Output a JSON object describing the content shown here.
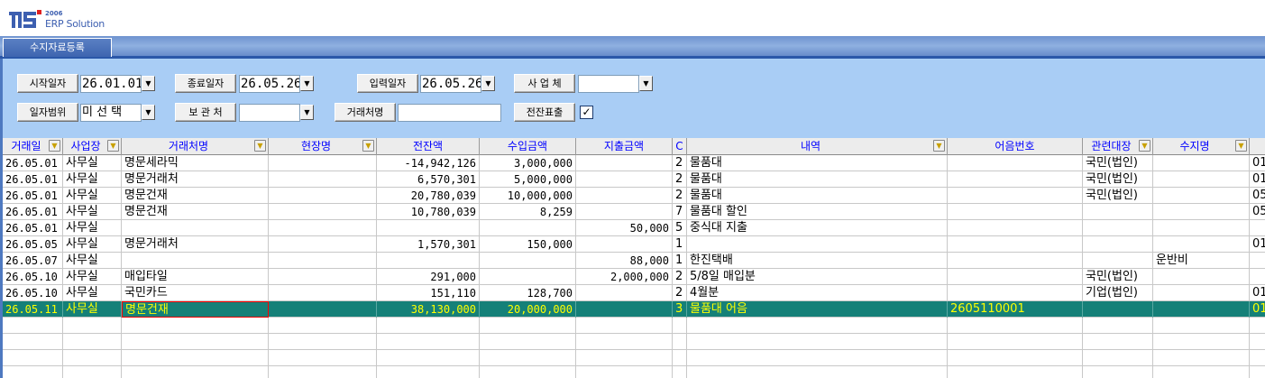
{
  "app": {
    "logo_year": "2006",
    "logo_name": "ERP Solution"
  },
  "tab": {
    "label": "수지자료등록"
  },
  "filters": {
    "start_date_label": "시작일자",
    "start_date_value": "26.01.01",
    "end_date_label": "종료일자",
    "end_date_value": "26.05.26",
    "input_date_label": "입력일자",
    "input_date_value": "26.05.26",
    "company_label": "사 업 체",
    "company_value": "",
    "date_range_label": "일자범위",
    "date_range_value": "미 선 택",
    "storage_label": "보 관 처",
    "storage_value": "",
    "vendor_label": "거래처명",
    "vendor_value": "",
    "slip_label": "전잔표출",
    "slip_checked": "✓"
  },
  "grid": {
    "columns": [
      "거래일",
      "사업장",
      "거래처명",
      "현장명",
      "전잔액",
      "수입금액",
      "지출금액",
      "C",
      "내역",
      "어음번호",
      "관련대장",
      "수지명"
    ],
    "rows": [
      {
        "date": "26.05.01",
        "site": "사무실",
        "vendor": "명문세라믹",
        "field": "",
        "balance": "-14,942,126",
        "income": "3,000,000",
        "expense": "",
        "c": "2",
        "desc": "물품대",
        "note": "",
        "ledger": "국민(법인)",
        "category": "",
        "extra": "01"
      },
      {
        "date": "26.05.01",
        "site": "사무실",
        "vendor": "명문거래처",
        "field": "",
        "balance": "6,570,301",
        "income": "5,000,000",
        "expense": "",
        "c": "2",
        "desc": "물품대",
        "note": "",
        "ledger": "국민(법인)",
        "category": "",
        "extra": "01"
      },
      {
        "date": "26.05.01",
        "site": "사무실",
        "vendor": "명문건재",
        "field": "",
        "balance": "20,780,039",
        "income": "10,000,000",
        "expense": "",
        "c": "2",
        "desc": "물품대",
        "note": "",
        "ledger": "국민(법인)",
        "category": "",
        "extra": "05"
      },
      {
        "date": "26.05.01",
        "site": "사무실",
        "vendor": "명문건재",
        "field": "",
        "balance": "10,780,039",
        "income": "8,259",
        "expense": "",
        "c": "7",
        "desc": "물품대 할인",
        "note": "",
        "ledger": "",
        "category": "",
        "extra": "05"
      },
      {
        "date": "26.05.01",
        "site": "사무실",
        "vendor": "",
        "field": "",
        "balance": "",
        "income": "",
        "expense": "50,000",
        "c": "5",
        "desc": "중식대 지출",
        "note": "",
        "ledger": "",
        "category": "",
        "extra": ""
      },
      {
        "date": "26.05.05",
        "site": "사무실",
        "vendor": "명문거래처",
        "field": "",
        "balance": "1,570,301",
        "income": "150,000",
        "expense": "",
        "c": "1",
        "desc": "",
        "note": "",
        "ledger": "",
        "category": "",
        "extra": "01"
      },
      {
        "date": "26.05.07",
        "site": "사무실",
        "vendor": "",
        "field": "",
        "balance": "",
        "income": "",
        "expense": "88,000",
        "c": "1",
        "desc": "한진택배",
        "note": "",
        "ledger": "",
        "category": "운반비",
        "extra": ""
      },
      {
        "date": "26.05.10",
        "site": "사무실",
        "vendor": "매입타일",
        "field": "",
        "balance": "291,000",
        "income": "",
        "expense": "2,000,000",
        "c": "2",
        "desc": "5/8일 매입분",
        "note": "",
        "ledger": "국민(법인)",
        "category": "",
        "extra": ""
      },
      {
        "date": "26.05.10",
        "site": "사무실",
        "vendor": "국민카드",
        "field": "",
        "balance": "151,110",
        "income": "128,700",
        "expense": "",
        "c": "2",
        "desc": "4월분",
        "note": "",
        "ledger": "기업(법인)",
        "category": "",
        "extra": "01"
      },
      {
        "date": "26.05.11",
        "site": "사무실",
        "vendor": "명문건재",
        "field": "",
        "balance": "38,130,000",
        "income": "20,000,000",
        "expense": "",
        "c": "3",
        "desc": "물품대 어음",
        "note": "2605110001",
        "ledger": "",
        "category": "",
        "extra": "01"
      }
    ]
  }
}
